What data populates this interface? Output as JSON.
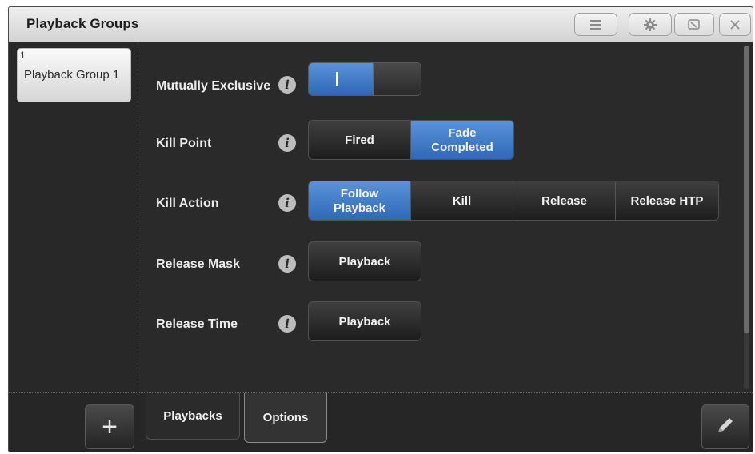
{
  "window": {
    "title": "Playback Groups",
    "title_buttons": [
      {
        "icon": "menu-icon"
      },
      {
        "icon": "gear-icon"
      },
      {
        "icon": "resize-icon"
      },
      {
        "icon": "close-icon"
      }
    ]
  },
  "sidebar": {
    "groups": [
      {
        "number": "1",
        "label": "Playback Group 1",
        "selected": true
      }
    ]
  },
  "options": {
    "mutually_exclusive": {
      "label": "Mutually Exclusive",
      "value": true
    },
    "kill_point": {
      "label": "Kill Point",
      "options": [
        "Fired",
        "Fade\nCompleted"
      ],
      "selected": 1
    },
    "kill_action": {
      "label": "Kill Action",
      "options": [
        "Follow\nPlayback",
        "Kill",
        "Release",
        "Release HTP"
      ],
      "selected": 0
    },
    "release_mask": {
      "label": "Release Mask",
      "value": "Playback"
    },
    "release_time": {
      "label": "Release Time",
      "value": "Playback"
    }
  },
  "bottom": {
    "add_symbol": "+",
    "tabs": [
      "Playbacks",
      "Options"
    ],
    "active_tab": "Options"
  },
  "colors": {
    "accent_blue": "#3a76c6",
    "background": "#2a2a2a",
    "titlebar": "#e0e0e0"
  }
}
